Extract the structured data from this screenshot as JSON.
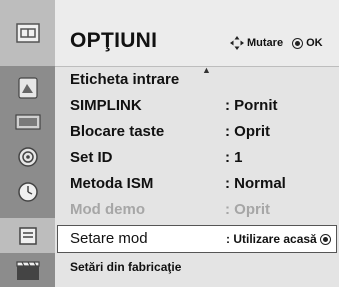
{
  "menu": {
    "title": "OPŢIUNI",
    "hint_move": "Mutare",
    "hint_ok": "OK"
  },
  "sidebar": {
    "items": [
      {
        "icon": "option-menu-icon"
      },
      {
        "icon": "picture-icon"
      },
      {
        "icon": "screen-icon"
      },
      {
        "icon": "audio-icon"
      },
      {
        "icon": "time-icon"
      },
      {
        "icon": "option-icon"
      },
      {
        "icon": "film-icon"
      }
    ]
  },
  "rows": [
    {
      "label": "Eticheta intrare",
      "value": ""
    },
    {
      "label": "SIMPLINK",
      "value": ": Pornit"
    },
    {
      "label": "Blocare taste",
      "value": ": Oprit"
    },
    {
      "label": "Set ID",
      "value": ": 1"
    },
    {
      "label": "Metoda ISM",
      "value": ": Normal"
    },
    {
      "label": "Mod demo",
      "value": ": Oprit"
    },
    {
      "label": "Setare mod",
      "value": ": Utilizare acasă"
    },
    {
      "label": "Setări din fabricaţie",
      "value": ""
    }
  ]
}
